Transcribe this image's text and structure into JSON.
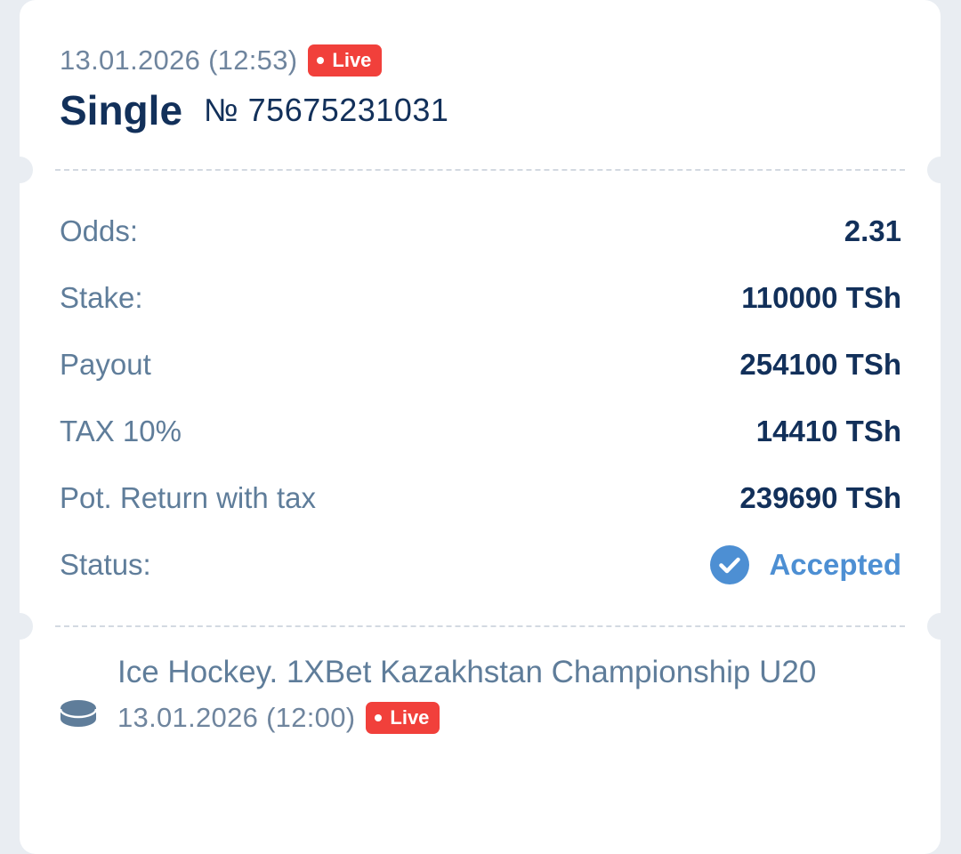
{
  "header": {
    "date_time": "13.01.2026 (12:53)",
    "live_label": "Live",
    "bet_type": "Single",
    "bet_number": "№ 75675231031"
  },
  "details": {
    "odds_label": "Odds:",
    "odds_value": "2.31",
    "stake_label": "Stake:",
    "stake_value": "110000 TSh",
    "payout_label": "Payout",
    "payout_value": "254100 TSh",
    "tax_label": "TAX 10%",
    "tax_value": "14410 TSh",
    "return_label": "Pot. Return with tax",
    "return_value": "239690 TSh",
    "status_label": "Status:",
    "status_value": "Accepted"
  },
  "event": {
    "title": "Ice Hockey. 1XBet Kazakhstan Championship U20",
    "date_time": "13.01.2026 (12:00)",
    "live_label": "Live",
    "sport_icon": "hockey-puck-icon"
  },
  "colors": {
    "live_badge": "#f1403b",
    "accepted": "#4d8fd3",
    "primary_text": "#12305a",
    "secondary_text": "#5f7d9a",
    "background": "#e9edf2"
  }
}
